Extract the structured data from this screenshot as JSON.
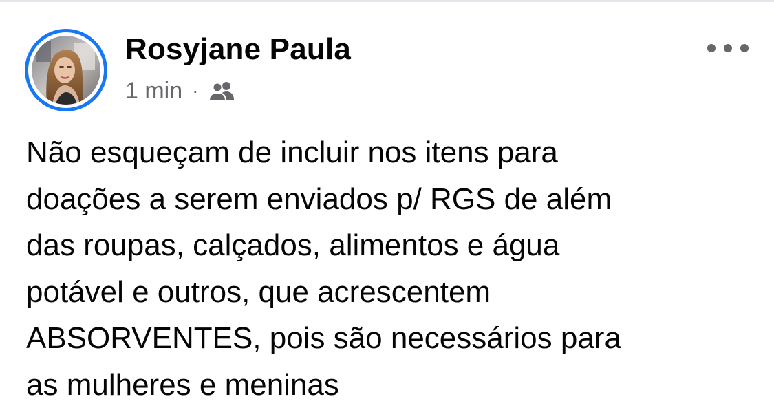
{
  "post": {
    "author_name": "Rosyjane Paula",
    "timestamp": "1 min",
    "separator": "·",
    "audience_icon": "friends-icon",
    "more_icon": "more-options-icon",
    "text_lines": [
      "Não esqueçam de incluir nos itens para",
      "doações a serem enviados p/ RGS de além",
      "das roupas, calçados, alimentos e água",
      "potável e outros, que acrescentem",
      "ABSORVENTES, pois são necessários para",
      "as mulheres e meninas"
    ]
  },
  "colors": {
    "avatar_ring": "#1877f2",
    "author_text": "#050505",
    "meta_text": "#65676b",
    "background": "#ffffff"
  }
}
